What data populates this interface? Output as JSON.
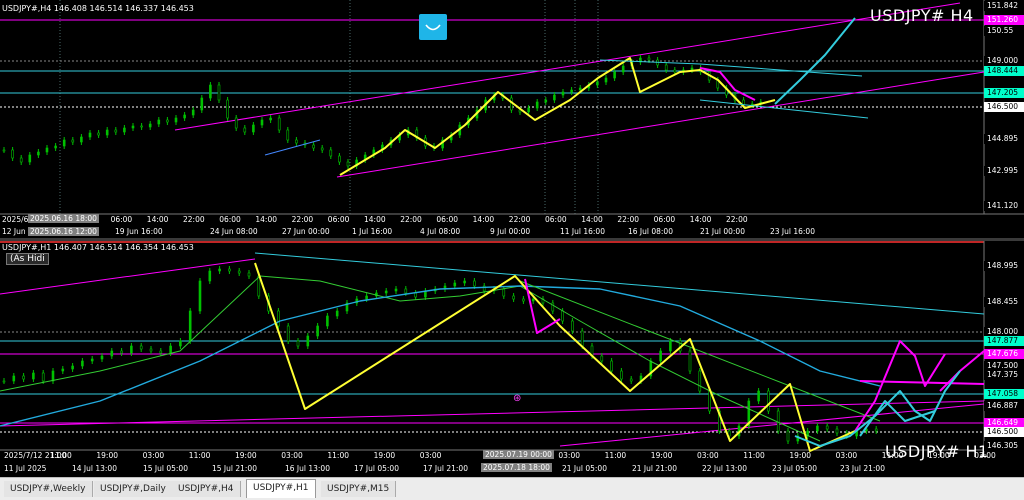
{
  "top": {
    "header": "USDJPY#,H4  146.408 146.514 146.337 146.453",
    "symbol_label": "USDJPY# H4",
    "prices": [
      {
        "text": "151.842",
        "bg": "#000000",
        "fg": "#ffffff"
      },
      {
        "text": "151.260",
        "bg": "#ff00ff",
        "fg": "#ffffff"
      },
      {
        "text": "150.55",
        "bg": "#000000",
        "fg": "#ffffff"
      },
      {
        "text": "149.000",
        "bg": "#000000",
        "fg": "#ffffff"
      },
      {
        "text": "148.444",
        "bg": "#00ffcc",
        "fg": "#000000"
      },
      {
        "text": "147.205",
        "bg": "#00ffcc",
        "fg": "#000000"
      },
      {
        "text": "146.500",
        "bg": "#ffffff",
        "fg": "#000000"
      },
      {
        "text": "144.895",
        "bg": "#000000",
        "fg": "#ffffff"
      },
      {
        "text": "142.995",
        "bg": "#000000",
        "fg": "#ffffff"
      },
      {
        "text": "141.120",
        "bg": "#000000",
        "fg": "#ffffff"
      }
    ],
    "mid_ticks": [
      "2025/6",
      "14:00",
      "22:00",
      "06:00",
      "14:00",
      "22:00",
      "06:00",
      "14:00",
      "22:00",
      "06:00",
      "14:00",
      "22:00",
      "06:00",
      "14:00",
      "22:00",
      "06:00",
      "14:00",
      "22:00",
      "06:00",
      "14:00",
      "22:00"
    ],
    "mid_box": "2025.06.16 18:00",
    "bottom_ticks": [
      "12 Jun",
      "2025.06.16 12:00",
      "19 Jun 16:00",
      "24 Jun 08:00",
      "27 Jun 00:00",
      "1 Jul 16:00",
      "4 Jul 08:00",
      "9 Jul 00:00",
      "11 Jul 16:00",
      "16 Jul 08:00",
      "21 Jul 00:00",
      "23 Jul 16:00"
    ]
  },
  "bottom": {
    "header": "USDJPY#,H1  146.407 146.514 146.354 146.453",
    "indicator_label": "(As Hidi",
    "symbol_label": "USDJPY# H1",
    "marker_glyph": "⊛",
    "prices": [
      {
        "text": "148.995",
        "bg": "#000000",
        "fg": "#ffffff"
      },
      {
        "text": "148.455",
        "bg": "#000000",
        "fg": "#ffffff"
      },
      {
        "text": "148.000",
        "bg": "#000000",
        "fg": "#ffffff"
      },
      {
        "text": "147.877",
        "bg": "#00ffcc",
        "fg": "#000000"
      },
      {
        "text": "147.676",
        "bg": "#ff00ff",
        "fg": "#ffffff"
      },
      {
        "text": "147.500",
        "bg": "#000000",
        "fg": "#ffffff"
      },
      {
        "text": "147.375",
        "bg": "#000000",
        "fg": "#ffffff"
      },
      {
        "text": "147.058",
        "bg": "#00ffcc",
        "fg": "#000000"
      },
      {
        "text": "146.887",
        "bg": "#000000",
        "fg": "#ffffff"
      },
      {
        "text": "146.649",
        "bg": "#ff00ff",
        "fg": "#ffffff"
      },
      {
        "text": "146.500",
        "bg": "#ffffff",
        "fg": "#000000"
      },
      {
        "text": "146.305",
        "bg": "#000000",
        "fg": "#ffffff"
      }
    ],
    "mid_ticks": [
      "2025/7/12 21:00",
      "11:00",
      "19:00",
      "03:00",
      "11:00",
      "19:00",
      "03:00",
      "11:00",
      "19:00",
      "03:00",
      "11:00",
      "19:00",
      "03:00",
      "11:00",
      "19:00",
      "03:00",
      "11:00",
      "19:00",
      "03:00",
      "11:00",
      "19:00",
      "03:00"
    ],
    "mid_box": "2025.07.19 00:00",
    "bottom_box": "2025.07.18 18:00",
    "bottom_ticks": [
      "11 Jul 2025",
      "14 Jul 13:00",
      "15 Jul 05:00",
      "15 Jul 21:00",
      "16 Jul 13:00",
      "17 Jul 05:00",
      "17 Jul 21:00",
      "21 Jul 05:00",
      "21 Jul 21:00",
      "22 Jul 13:00",
      "23 Jul 05:00",
      "23 Jul 21:00"
    ]
  },
  "tabs": [
    {
      "label": "USDJPY#,Weekly",
      "active": false
    },
    {
      "label": "USDJPY#,Daily",
      "active": false
    },
    {
      "label": "USDJPY#,H4",
      "active": false
    },
    {
      "label": "USDJPY#,H1",
      "active": true
    },
    {
      "label": "USDJPY#,M15",
      "active": false
    }
  ],
  "colors": {
    "bg": "#000000",
    "candle": "#00c000",
    "zigzag": "#ffff33",
    "channel": "#ff00ff",
    "forecast": "#33ccdd",
    "ma_green": "#33cc33",
    "ma_cyan": "#22aadd",
    "grid": "#2f4f4f"
  }
}
